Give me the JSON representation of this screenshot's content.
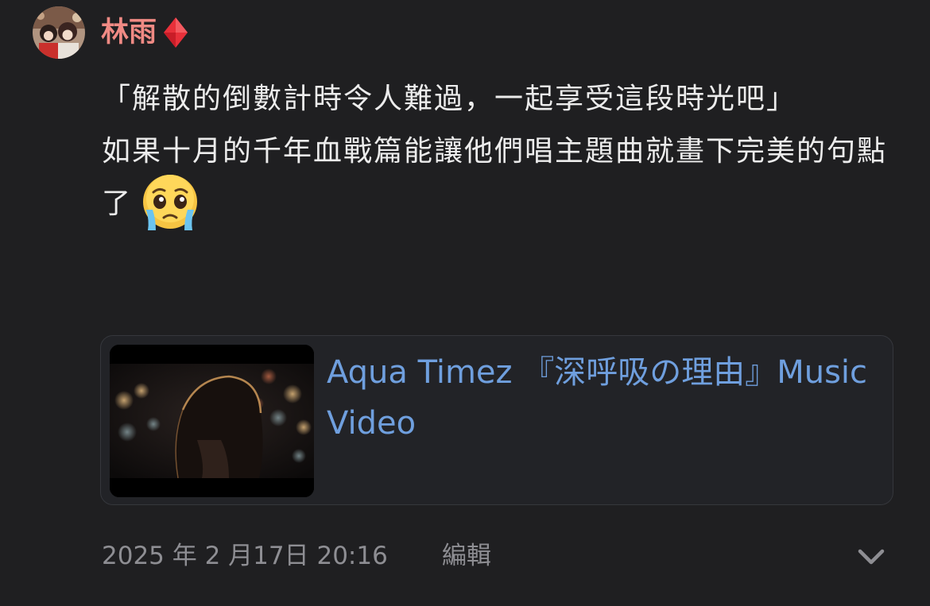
{
  "post": {
    "author": {
      "name": "林雨",
      "badge_icon": "red-diamond-icon",
      "avatar_icon": "avatar-image"
    },
    "body": {
      "paragraph_1": "「解散的倒數計時令人難過，一起享受這段時光吧」",
      "paragraph_2": "如果十月的千年血戰篇能讓他們唱主題曲就畫下完美的句點了",
      "emoji": "face-holding-back-tears-icon"
    },
    "link_card": {
      "title": "Aqua Timez 『深呼吸の理由』Music Video",
      "thumbnail": "video-thumbnail-image"
    },
    "footer": {
      "timestamp": "2025 年 2 月17日 20:16",
      "edit_label": "編輯",
      "expand_icon": "chevron-down-icon"
    }
  },
  "colors": {
    "background": "#1f1f21",
    "author_name": "#f08a84",
    "body_text": "#ececec",
    "link_text": "#6f9fde",
    "meta_text": "#8e8e93",
    "card_background": "#222327",
    "card_border": "#35373c"
  }
}
